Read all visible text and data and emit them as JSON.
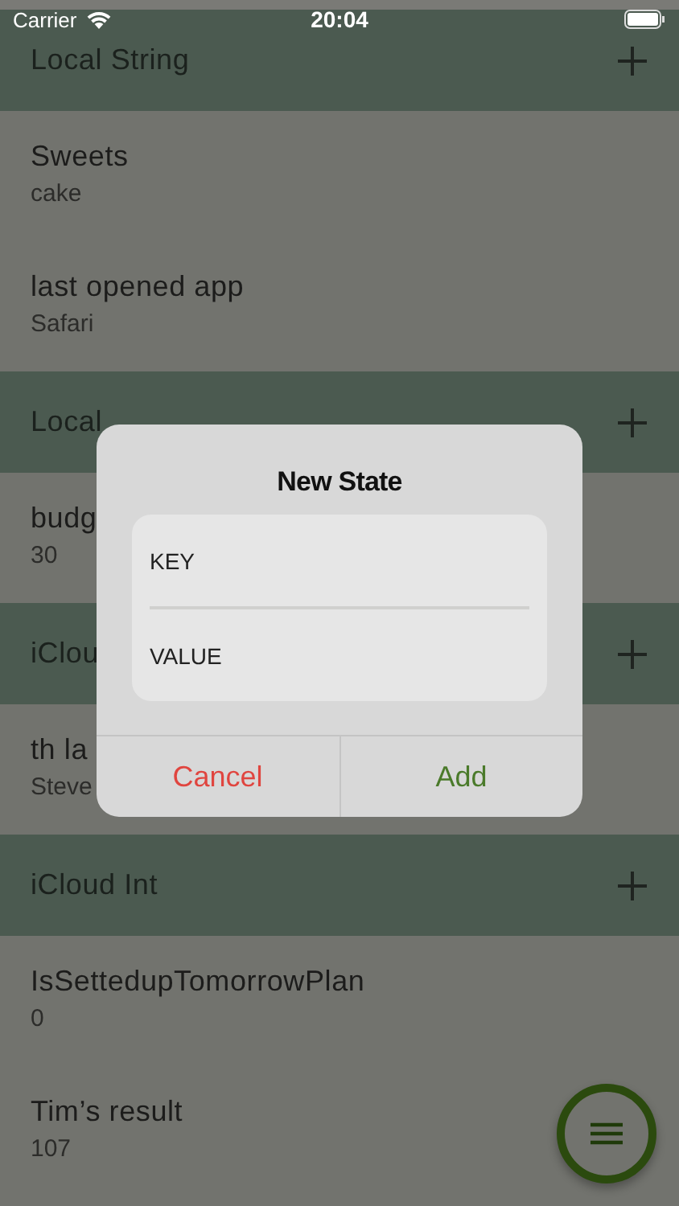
{
  "status_bar": {
    "carrier": "Carrier",
    "time": "20:04"
  },
  "sections": [
    {
      "title": "Local String",
      "rows": [
        {
          "name": "Sweets",
          "value": "cake"
        },
        {
          "name": "last opened app",
          "value": "Safari"
        }
      ]
    },
    {
      "title": "Local",
      "rows": [
        {
          "name": "budg",
          "value": "30"
        }
      ]
    },
    {
      "title": "iClou",
      "rows": [
        {
          "name": "th la",
          "value": "Steve"
        }
      ]
    },
    {
      "title": "iCloud Int",
      "rows": [
        {
          "name": "IsSettedupTomorrowPlan",
          "value": "0"
        },
        {
          "name": "Tim’s result",
          "value": "107"
        }
      ]
    }
  ],
  "dialog": {
    "title": "New State",
    "fields": [
      {
        "placeholder": "KEY"
      },
      {
        "placeholder": "VALUE"
      }
    ],
    "buttons": [
      {
        "label": "Cancel",
        "kind": "cancel"
      },
      {
        "label": "Add",
        "kind": "confirm"
      }
    ]
  }
}
